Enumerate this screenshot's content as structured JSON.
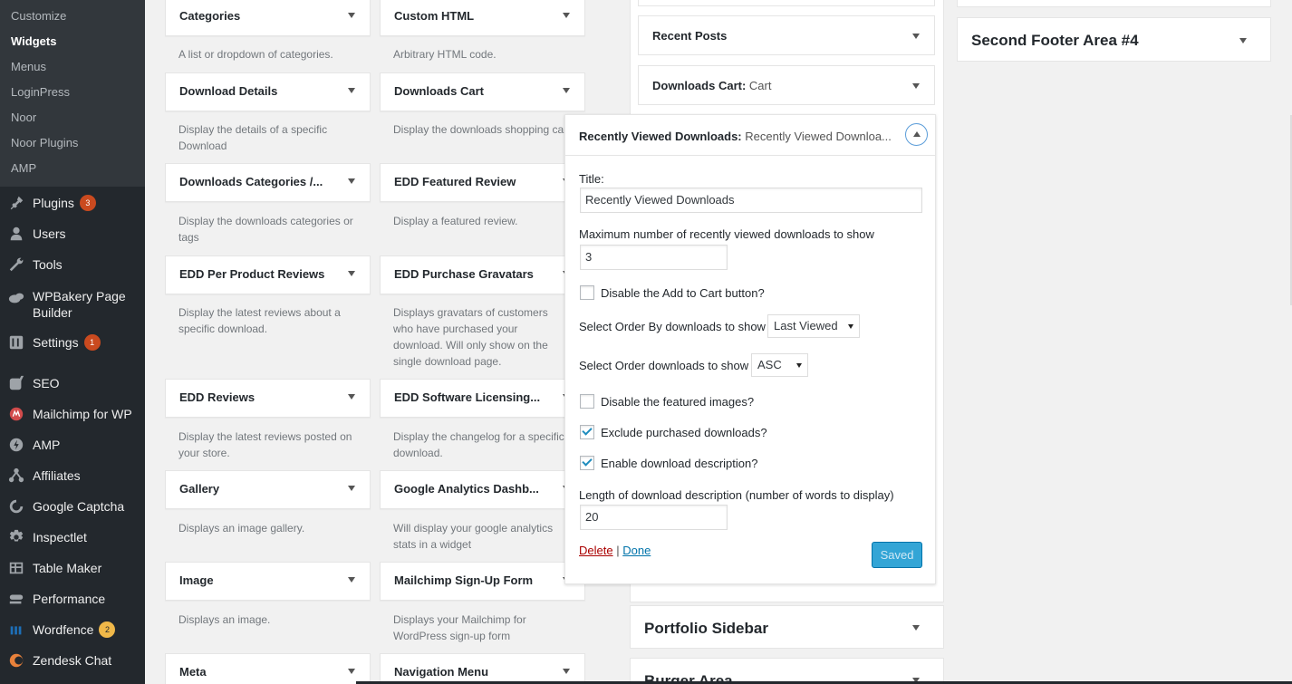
{
  "sidebar": {
    "submenu": [
      {
        "label": "Customize"
      },
      {
        "label": "Widgets"
      },
      {
        "label": "Menus"
      },
      {
        "label": "LoginPress"
      },
      {
        "label": "Noor"
      },
      {
        "label": "Noor Plugins"
      },
      {
        "label": "AMP"
      }
    ],
    "menu": [
      {
        "label": "Plugins",
        "badge": "3",
        "icon": "plug-icon"
      },
      {
        "label": "Users",
        "icon": "users-icon"
      },
      {
        "label": "Tools",
        "icon": "wrench-icon"
      },
      {
        "label": "WPBakery Page Builder",
        "icon": "wpbakery-icon"
      },
      {
        "label": "Settings",
        "badge": "1",
        "icon": "settings-icon"
      },
      {
        "label": "SEO",
        "icon": "yoast-icon"
      },
      {
        "label": "Mailchimp for WP",
        "icon": "mailchimp-icon"
      },
      {
        "label": "AMP",
        "icon": "amp-icon"
      },
      {
        "label": "Affiliates",
        "icon": "affiliates-icon"
      },
      {
        "label": "Google Captcha",
        "icon": "captcha-icon"
      },
      {
        "label": "Inspectlet",
        "icon": "gear-icon"
      },
      {
        "label": "Table Maker",
        "icon": "table-icon"
      },
      {
        "label": "Performance",
        "icon": "performance-icon"
      },
      {
        "label": "Wordfence",
        "badge": "2",
        "icon": "wordfence-icon"
      },
      {
        "label": "Zendesk Chat",
        "icon": "zendesk-icon"
      }
    ]
  },
  "widgets": [
    {
      "title": "Categories",
      "desc": "A list or dropdown of categories."
    },
    {
      "title": "Custom HTML",
      "desc": "Arbitrary HTML code."
    },
    {
      "title": "Download Details",
      "desc": "Display the details of a specific Download"
    },
    {
      "title": "Downloads Cart",
      "desc": "Display the downloads shopping cart"
    },
    {
      "title": "Downloads Categories /...",
      "desc": "Display the downloads categories or tags"
    },
    {
      "title": "EDD Featured Review",
      "desc": "Display a featured review."
    },
    {
      "title": "EDD Per Product Reviews",
      "desc": "Display the latest reviews about a specific download."
    },
    {
      "title": "EDD Purchase Gravatars",
      "desc": "Displays gravatars of customers who have purchased your download. Will only show on the single download page."
    },
    {
      "title": "EDD Reviews",
      "desc": "Display the latest reviews posted on your store."
    },
    {
      "title": "EDD Software Licensing...",
      "desc": "Display the changelog for a specific download."
    },
    {
      "title": "Gallery",
      "desc": "Displays an image gallery."
    },
    {
      "title": "Google Analytics Dashb...",
      "desc": "Will display your google analytics stats in a widget"
    },
    {
      "title": "Image",
      "desc": "Displays an image."
    },
    {
      "title": "Mailchimp Sign-Up Form",
      "desc": "Displays your Mailchimp for WordPress sign-up form"
    },
    {
      "title": "Meta",
      "desc": ""
    },
    {
      "title": "Navigation Menu",
      "desc": ""
    }
  ],
  "sidebar_area": {
    "recent_posts": "Recent Posts",
    "downloads_cart": {
      "name": "Downloads Cart:",
      "instance": "Cart"
    },
    "portfolio_sidebar": "Portfolio Sidebar",
    "burger_area": "Burger Area",
    "second_footer_4": "Second Footer Area #4"
  },
  "expanded": {
    "name": "Recently Viewed Downloads:",
    "instance": "Recently Viewed Downloa...",
    "title_label": "Title:",
    "title_value": "Recently Viewed Downloads",
    "max_label": "Maximum number of recently viewed downloads to show",
    "max_value": "3",
    "disable_cart_label": "Disable the Add to Cart button?",
    "disable_cart": false,
    "order_by_label": "Select Order By downloads to show",
    "order_by_value": "Last Viewed",
    "order_label": "Select Order downloads to show",
    "order_value": "ASC",
    "disable_images_label": "Disable the featured images?",
    "disable_images": false,
    "exclude_label": "Exclude purchased downloads?",
    "exclude": true,
    "enable_desc_label": "Enable download description?",
    "enable_desc": true,
    "length_label": "Length of download description (number of words to display)",
    "length_value": "20",
    "delete": "Delete",
    "separator": "|",
    "done": "Done",
    "saved": "Saved"
  },
  "colors": {
    "sidebar_bg": "#23282d",
    "submenu_bg": "#32373c",
    "link_blue": "#0073aa",
    "delete_red": "#a00",
    "badge_red": "#ca4a1f",
    "badge_yellow": "#f0b849"
  }
}
